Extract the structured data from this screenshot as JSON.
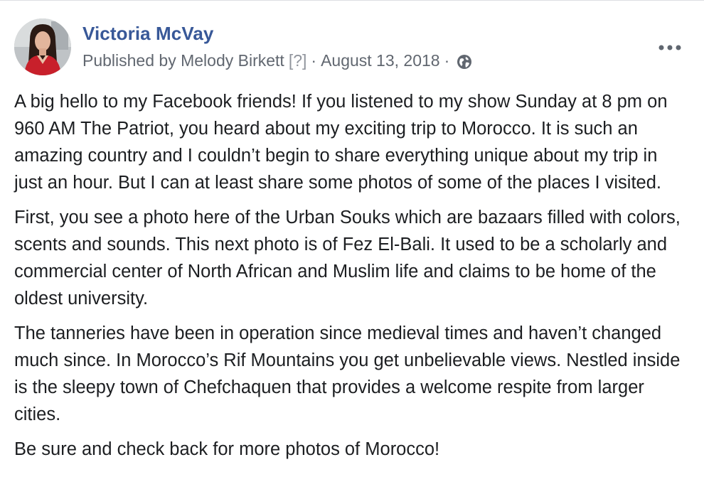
{
  "post": {
    "author": "Victoria McVay",
    "publisher_prefix": "Published by Melody Birkett",
    "publisher_help": "[?]",
    "separator": "·",
    "date": "August 13, 2018",
    "privacy_icon": "globe-icon",
    "menu_icon": "more-horizontal-icon",
    "paragraphs": [
      "A big hello to my Facebook friends! If you listened to my show Sunday at 8 pm on 960 AM The Patriot, you heard about my exciting trip to Morocco. It is such an amazing country and I couldn’t begin to share everything unique about my trip in just an hour. But I can at least share some photos of some of the places I visited.",
      "First, you see a photo here of the Urban Souks which are bazaars filled with colors, scents and sounds. This next photo is of Fez El-Bali. It used to be a scholarly and commercial center of North African and Muslim life and claims to be home of the oldest university.",
      "The tanneries have been in operation since medieval times and haven’t changed much since. In Morocco’s Rif Mountains you get unbelievable views. Nestled inside is the sleepy town of Chefchaquen that provides a welcome respite from larger cities.",
      "Be sure and check back for more photos of Morocco!"
    ]
  },
  "colors": {
    "link": "#385898",
    "meta": "#616770",
    "text": "#1c1e21"
  }
}
